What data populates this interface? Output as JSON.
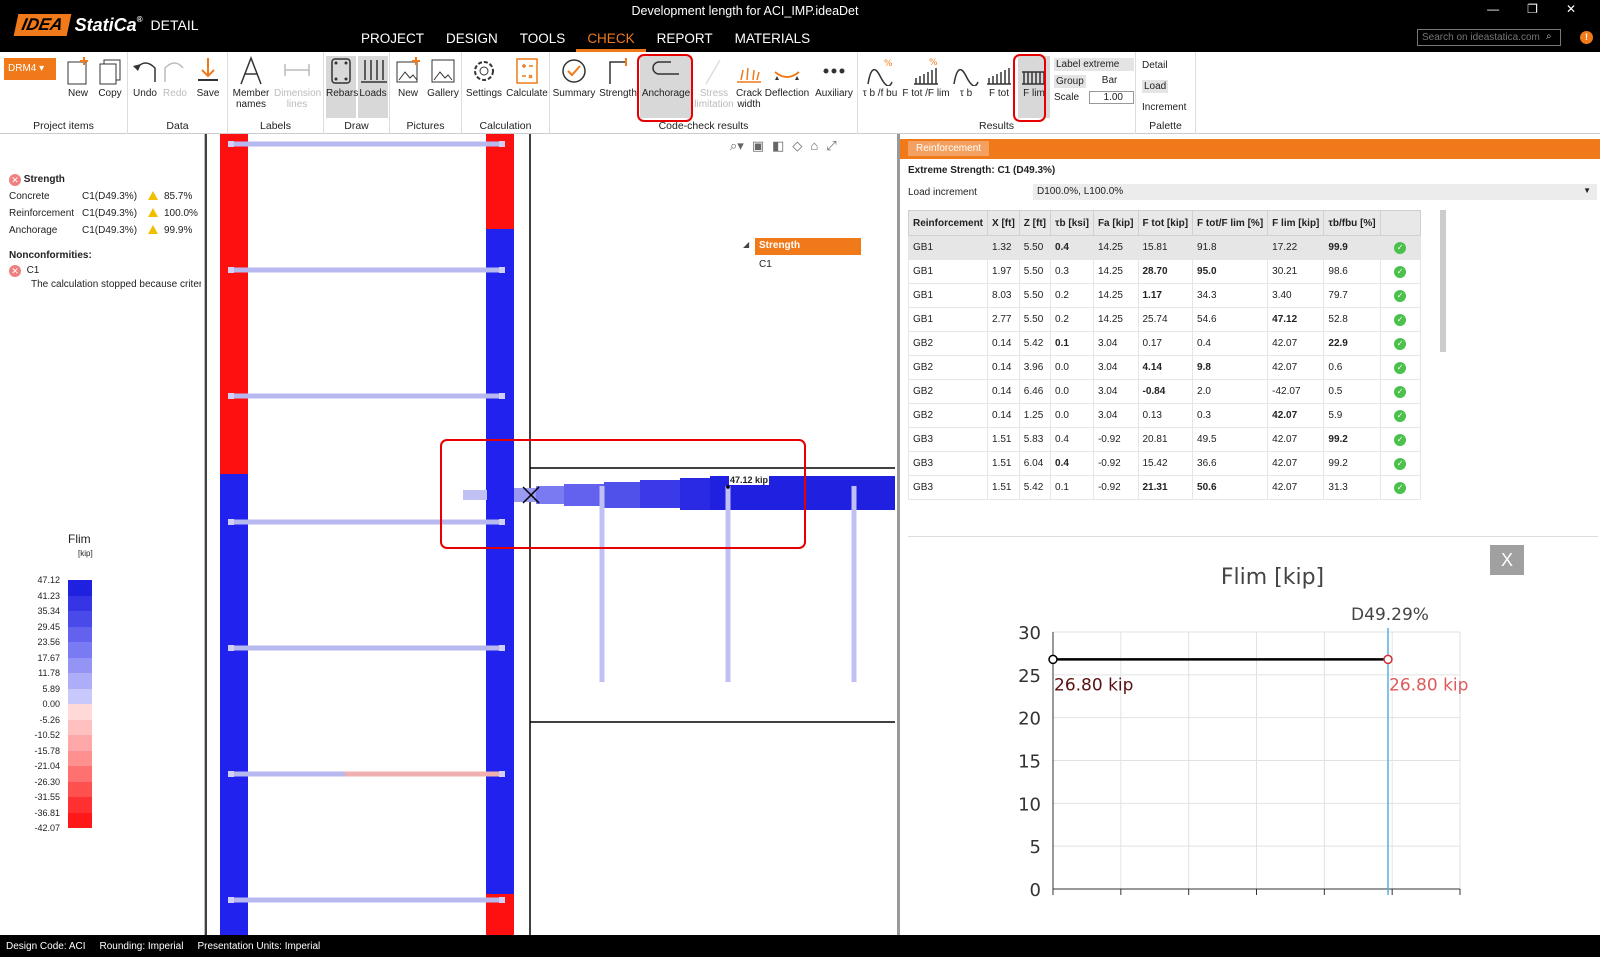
{
  "app": {
    "logo_idea": "IDEA",
    "logo_statica": "StatiCa",
    "logo_reg": "®",
    "logo_product": "DETAIL",
    "window_title": "Development length for ACI_IMP.ideaDet",
    "window_controls": [
      "—",
      "❐",
      "✕"
    ],
    "search_placeholder": "Search on ideastatica.com"
  },
  "menu": [
    "PROJECT",
    "DESIGN",
    "TOOLS",
    "CHECK",
    "REPORT",
    "MATERIALS"
  ],
  "menu_active": "CHECK",
  "ribbon": {
    "project_selector": "DRM4",
    "groups": {
      "project_items": "Project items",
      "data": "Data",
      "labels": "Labels",
      "draw": "Draw",
      "pictures": "Pictures",
      "calculation": "Calculation",
      "code_check": "Code-check results",
      "results": "Results",
      "palette": "Palette"
    },
    "buttons": {
      "new": "New",
      "copy": "Copy",
      "undo": "Undo",
      "redo": "Redo",
      "save": "Save",
      "member_names": "Member names",
      "dimension_lines": "Dimension lines",
      "rebars": "Rebars",
      "loads": "Loads",
      "pic_new": "New",
      "gallery": "Gallery",
      "settings": "Settings",
      "calculate": "Calculate",
      "summary": "Summary",
      "strength": "Strength",
      "anchorage": "Anchorage",
      "stress_limitation": "Stress limitation",
      "crack_width": "Crack width",
      "deflection": "Deflection",
      "auxiliary": "Auxiliary",
      "tb_fbu": "τ b /f bu",
      "ftot_flim": "F tot /F lim",
      "tb": "τ b",
      "ftot": "F tot",
      "flim": "F lim"
    },
    "result_options": {
      "label_extreme": "Label extreme",
      "group": "Group",
      "bar": "Bar",
      "scale_label": "Scale",
      "scale_value": "1.00"
    },
    "palette": {
      "detail": "Detail",
      "load": "Load",
      "increment": "Increment"
    }
  },
  "left_panel": {
    "strength_title": "Strength",
    "checks": [
      {
        "name": "Concrete",
        "case": "C1(D49.3%)",
        "value": "85.7%"
      },
      {
        "name": "Reinforcement",
        "case": "C1(D49.3%)",
        "value": "100.0%"
      },
      {
        "name": "Anchorage",
        "case": "C1(D49.3%)",
        "value": "99.9%"
      }
    ],
    "nonconformities_title": "Nonconformities:",
    "nonconformity_case": "C1",
    "nonconformity_text": "The calculation stopped because criteria...",
    "legend_title": "Flim",
    "legend_unit": "[kip]",
    "legend_values": [
      "47.12",
      "41.23",
      "35.34",
      "29.45",
      "23.56",
      "17.67",
      "11.78",
      "5.89",
      "0.00",
      "-5.26",
      "-10.52",
      "-15.78",
      "-21.04",
      "-26.30",
      "-31.55",
      "-36.81",
      "-42.07"
    ],
    "legend_colors": [
      "#2020e0",
      "#3535e6",
      "#4a4aea",
      "#6262ee",
      "#7a7af2",
      "#9494f5",
      "#aeaef8",
      "#c8c8fb",
      "#ffd8d8",
      "#ffc0c0",
      "#ffa8a8",
      "#ff9090",
      "#ff7070",
      "#ff5050",
      "#ff3030",
      "#ff1818",
      "#ff0000"
    ]
  },
  "viewport": {
    "tree_header": "Strength",
    "tree_item": "C1",
    "extreme_label": "47.12 kip"
  },
  "right_panel": {
    "tab": "Reinforcement",
    "extreme_title": "Extreme Strength: C1 (D49.3%)",
    "load_increment_label": "Load increment",
    "load_increment_value": "D100.0%, L100.0%",
    "columns": [
      "Reinforcement",
      "X [ft]",
      "Z [ft]",
      "τb [ksi]",
      "Fa [kip]",
      "F tot [kip]",
      "F tot/F lim [%]",
      "F lim [kip]",
      "τb/fbu [%]",
      ""
    ],
    "rows": [
      [
        "GB1",
        "1.32",
        "5.50",
        "0.4",
        "14.25",
        "15.81",
        "91.8",
        "17.22",
        "99.9"
      ],
      [
        "GB1",
        "1.97",
        "5.50",
        "0.3",
        "14.25",
        "28.70",
        "95.0",
        "30.21",
        "98.6"
      ],
      [
        "GB1",
        "8.03",
        "5.50",
        "0.2",
        "14.25",
        "1.17",
        "34.3",
        "3.40",
        "79.7"
      ],
      [
        "GB1",
        "2.77",
        "5.50",
        "0.2",
        "14.25",
        "25.74",
        "54.6",
        "47.12",
        "52.8"
      ],
      [
        "GB2",
        "0.14",
        "5.42",
        "0.1",
        "3.04",
        "0.17",
        "0.4",
        "42.07",
        "22.9"
      ],
      [
        "GB2",
        "0.14",
        "3.96",
        "0.0",
        "3.04",
        "4.14",
        "9.8",
        "42.07",
        "0.6"
      ],
      [
        "GB2",
        "0.14",
        "6.46",
        "0.0",
        "3.04",
        "-0.84",
        "2.0",
        "-42.07",
        "0.5"
      ],
      [
        "GB2",
        "0.14",
        "1.25",
        "0.0",
        "3.04",
        "0.13",
        "0.3",
        "42.07",
        "5.9"
      ],
      [
        "GB3",
        "1.51",
        "5.83",
        "0.4",
        "-0.92",
        "20.81",
        "49.5",
        "42.07",
        "99.2"
      ],
      [
        "GB3",
        "1.51",
        "6.04",
        "0.4",
        "-0.92",
        "15.42",
        "36.6",
        "42.07",
        "99.2"
      ],
      [
        "GB3",
        "1.51",
        "5.42",
        "0.1",
        "-0.92",
        "21.31",
        "50.6",
        "42.07",
        "31.3"
      ]
    ],
    "graph_close": "X"
  },
  "chart_data": {
    "type": "line",
    "title": "Flim [kip]",
    "series_label": "D49.29%",
    "x": [
      0,
      1
    ],
    "values": [
      26.8,
      26.8
    ],
    "point_labels": [
      "26.80 kip",
      "26.80 kip"
    ],
    "yticks": [
      0,
      5,
      10,
      15,
      20,
      25,
      30
    ],
    "ylim": [
      0,
      30
    ],
    "grid": true
  },
  "status": [
    "Design Code: ACI",
    "Rounding: Imperial",
    "Presentation Units: Imperial"
  ]
}
